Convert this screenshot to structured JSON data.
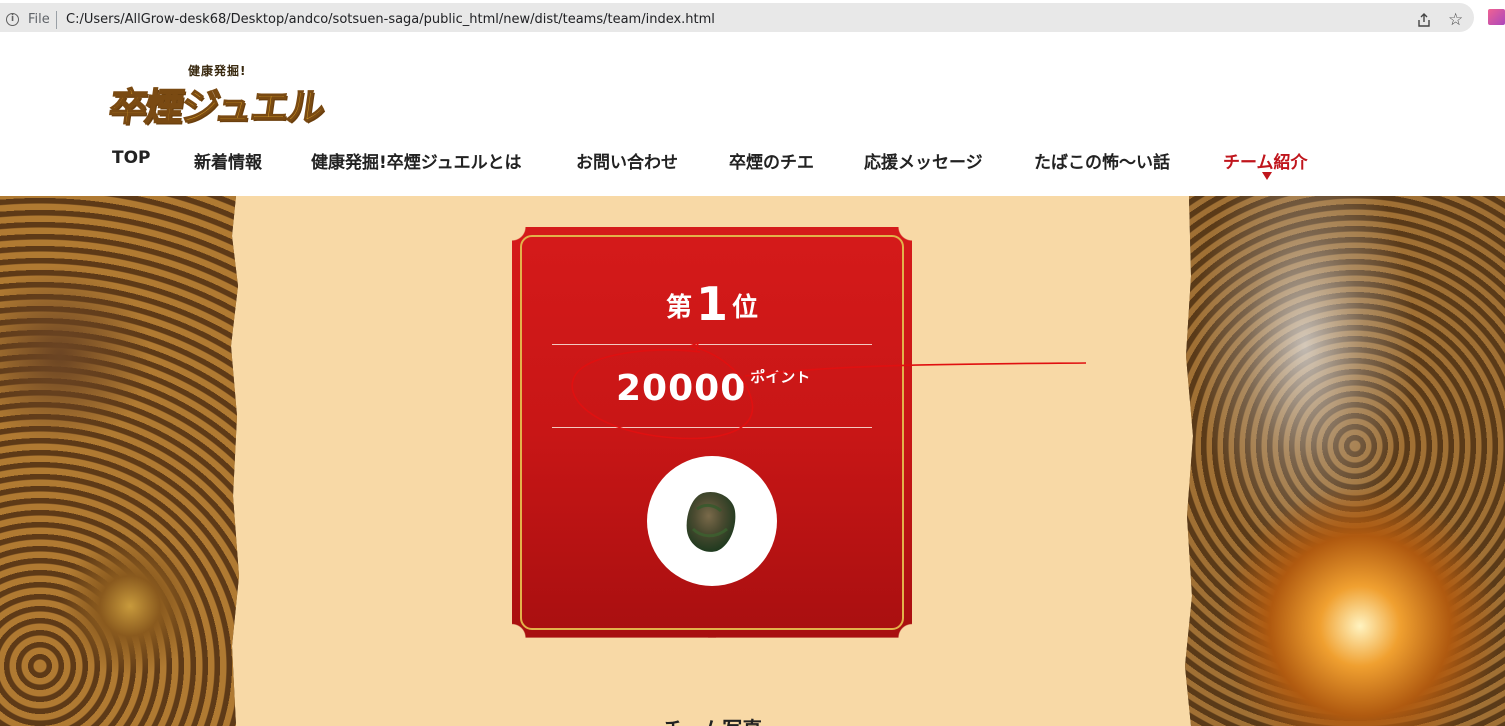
{
  "browser": {
    "scheme_label": "File",
    "url": "C:/Users/AllGrow-desk68/Desktop/andco/sotsuen-saga/public_html/new/dist/teams/team/index.html",
    "icons": [
      "info-icon",
      "share-icon",
      "star-icon",
      "extension-icon"
    ]
  },
  "header": {
    "logo_sub": "健康発掘!",
    "logo_main": "卒煙ジュエル",
    "nav": [
      {
        "label": "TOP"
      },
      {
        "label": "新着情報"
      },
      {
        "label": "健康発掘!卒煙ジュエルとは"
      },
      {
        "label": "お問い合わせ"
      },
      {
        "label": "卒煙のチエ"
      },
      {
        "label": "応援メッセージ"
      },
      {
        "label": "たばこの怖〜い話"
      },
      {
        "label": "チーム紹介",
        "active": true
      }
    ]
  },
  "card": {
    "rank_prefix": "第",
    "rank_number": "1",
    "rank_suffix": "位",
    "points_value": "20000",
    "points_unit": "ポイント"
  },
  "section": {
    "title": "チーム写真"
  },
  "colors": {
    "card_red": "#c81616",
    "accent_red": "#c0151c",
    "gold": "#e2b24a",
    "background": "#f8d9a6"
  }
}
